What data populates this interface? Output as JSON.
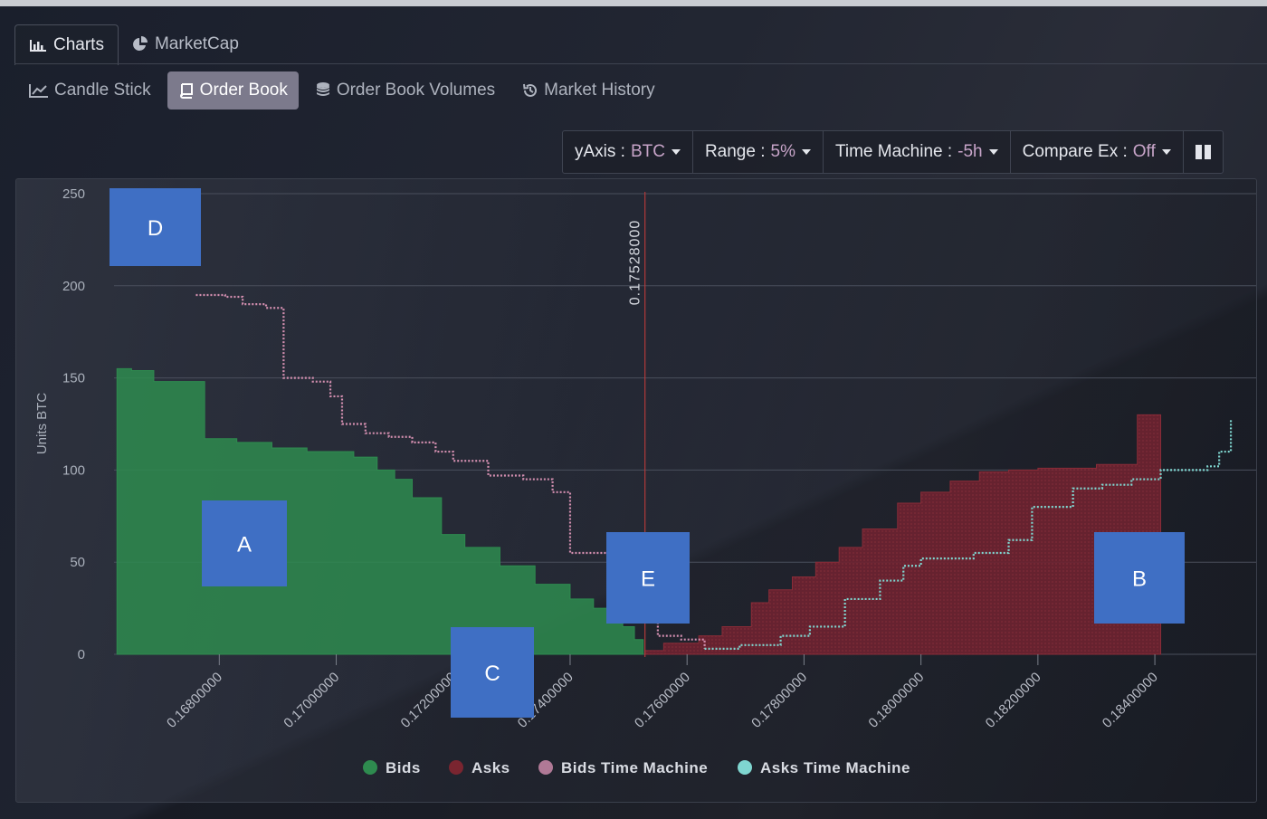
{
  "tabs": [
    {
      "label": "Charts",
      "icon": "bar-chart-icon",
      "active": true
    },
    {
      "label": "MarketCap",
      "icon": "pie-chart-icon",
      "active": false
    }
  ],
  "subtabs": [
    {
      "label": "Candle Stick",
      "icon": "line-chart-icon",
      "active": false
    },
    {
      "label": "Order Book",
      "icon": "book-icon",
      "active": true
    },
    {
      "label": "Order Book Volumes",
      "icon": "database-icon",
      "active": false
    },
    {
      "label": "Market History",
      "icon": "history-icon",
      "active": false
    }
  ],
  "toolbar": {
    "yaxis_label": "yAxis :",
    "yaxis_value": "BTC",
    "range_label": "Range :",
    "range_value": "5%",
    "time_label": "Time Machine :",
    "time_value": "-5h",
    "compare_label": "Compare Ex :",
    "compare_value": "Off",
    "columns_icon": "columns-icon"
  },
  "colors": {
    "bids": "#2e8b4f",
    "asks": "#7a2530",
    "bids_tm": "#d48fb0",
    "asks_tm": "#7fd6d0",
    "marker": "#3f6fc4",
    "midline": "#b03a3a"
  },
  "annotations": [
    "A",
    "B",
    "C",
    "D",
    "E"
  ],
  "chart_data": {
    "type": "area",
    "ylabel": "Units BTC",
    "ylim": [
      0,
      250
    ],
    "xlim": [
      0.1662,
      0.1855
    ],
    "yticks": [
      "0",
      "50",
      "100",
      "150",
      "200",
      "250"
    ],
    "xticks": [
      "0.16800000",
      "0.17000000",
      "0.17200000",
      "0.17400000",
      "0.17600000",
      "0.17800000",
      "0.18000000",
      "0.18200000",
      "0.18400000"
    ],
    "xtick_values": [
      0.168,
      0.17,
      0.172,
      0.174,
      0.176,
      0.178,
      0.18,
      0.182,
      0.184
    ],
    "mid_price_label": "0.17528000",
    "mid_price": 0.17528,
    "legend": [
      "Bids",
      "Asks",
      "Bids Time Machine",
      "Asks Time Machine"
    ],
    "series": [
      {
        "name": "Bids",
        "kind": "step-area",
        "x": [
          0.16625,
          0.1665,
          0.16688,
          0.16775,
          0.1683,
          0.1689,
          0.1695,
          0.1703,
          0.1707,
          0.171,
          0.1713,
          0.1718,
          0.1722,
          0.1728,
          0.1734,
          0.174,
          0.1744,
          0.1747,
          0.1749,
          0.1751,
          0.17525
        ],
        "y": [
          155,
          154,
          148,
          117,
          115,
          112,
          110,
          107,
          100,
          95,
          85,
          65,
          58,
          48,
          38,
          30,
          25,
          20,
          15,
          8,
          3
        ]
      },
      {
        "name": "Asks",
        "kind": "step-area",
        "x": [
          0.17528,
          0.1756,
          0.1762,
          0.1766,
          0.1771,
          0.1774,
          0.1778,
          0.1782,
          0.1786,
          0.179,
          0.1796,
          0.18,
          0.1805,
          0.181,
          0.1815,
          0.182,
          0.183,
          0.1837,
          0.1841
        ],
        "y": [
          2,
          6,
          10,
          15,
          28,
          35,
          42,
          50,
          58,
          68,
          82,
          88,
          94,
          99,
          100,
          101,
          103,
          130,
          130
        ]
      },
      {
        "name": "Bids Time Machine",
        "kind": "step-line",
        "x": [
          0.1676,
          0.1681,
          0.1684,
          0.1688,
          0.1691,
          0.1696,
          0.1699,
          0.1701,
          0.1705,
          0.1709,
          0.1713,
          0.1717,
          0.172,
          0.1726,
          0.1732,
          0.1737,
          0.174,
          0.1747,
          0.175,
          0.1752,
          0.1755,
          0.1759,
          0.1763
        ],
        "y": [
          195,
          194,
          190,
          188,
          150,
          148,
          140,
          125,
          120,
          118,
          115,
          110,
          105,
          97,
          95,
          88,
          55,
          52,
          40,
          20,
          10,
          8,
          3
        ]
      },
      {
        "name": "Asks Time Machine",
        "kind": "step-line",
        "x": [
          0.1763,
          0.1769,
          0.1776,
          0.1781,
          0.1787,
          0.1793,
          0.1797,
          0.18,
          0.1809,
          0.1815,
          0.1819,
          0.1826,
          0.1831,
          0.1836,
          0.1841,
          0.1849,
          0.1851,
          0.1853
        ],
        "y": [
          3,
          5,
          10,
          15,
          30,
          40,
          48,
          52,
          55,
          62,
          80,
          90,
          92,
          95,
          100,
          102,
          110,
          127
        ]
      }
    ]
  }
}
